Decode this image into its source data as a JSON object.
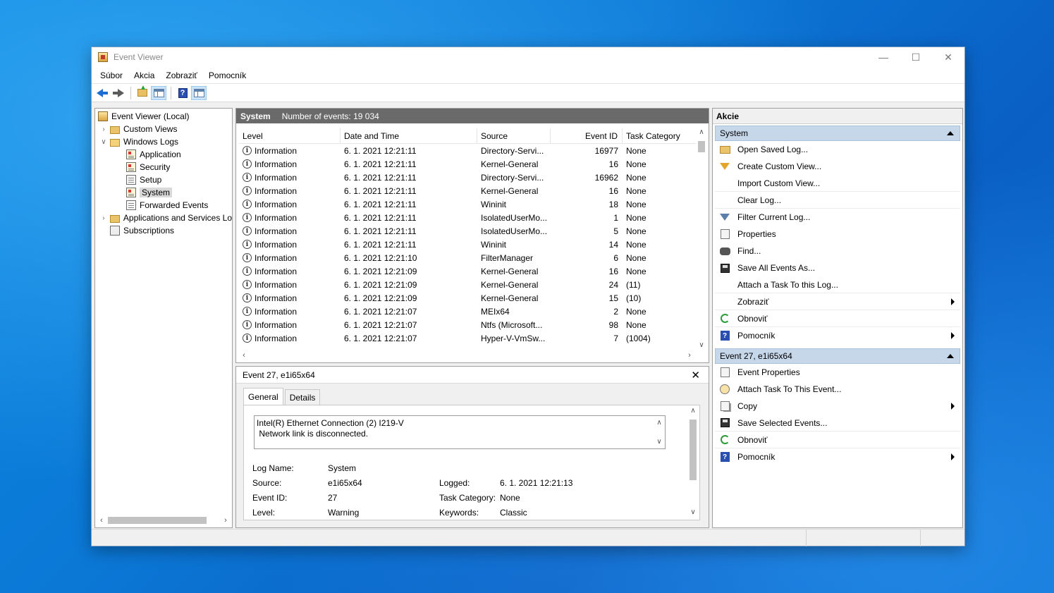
{
  "window": {
    "title": "Event Viewer",
    "controls": {
      "minimize": "—",
      "maximize": "☐",
      "close": "✕"
    }
  },
  "menu": [
    "Súbor",
    "Akcia",
    "Zobraziť",
    "Pomocník"
  ],
  "toolbar": {
    "icons": [
      "back-arrow-icon",
      "forward-arrow-icon",
      "up-folder-icon",
      "show-hide-console-tree-icon",
      "help-icon",
      "show-hide-action-pane-icon"
    ]
  },
  "tree": {
    "root": "Event Viewer (Local)",
    "custom_views": "Custom Views",
    "windows_logs": "Windows Logs",
    "logs": [
      "Application",
      "Security",
      "Setup",
      "System",
      "Forwarded Events"
    ],
    "apps_services": "Applications and Services Lo",
    "subscriptions": "Subscriptions",
    "selected": "System"
  },
  "list": {
    "header_title": "System",
    "header_count": "Number of events: 19 034",
    "columns": {
      "level": "Level",
      "date": "Date and Time",
      "source": "Source",
      "event_id": "Event ID",
      "task": "Task Category"
    },
    "rows": [
      {
        "level": "Information",
        "date": "6. 1. 2021 12:21:11",
        "source": "Directory-Servi...",
        "event_id": "16977",
        "task": "None"
      },
      {
        "level": "Information",
        "date": "6. 1. 2021 12:21:11",
        "source": "Kernel-General",
        "event_id": "16",
        "task": "None"
      },
      {
        "level": "Information",
        "date": "6. 1. 2021 12:21:11",
        "source": "Directory-Servi...",
        "event_id": "16962",
        "task": "None"
      },
      {
        "level": "Information",
        "date": "6. 1. 2021 12:21:11",
        "source": "Kernel-General",
        "event_id": "16",
        "task": "None"
      },
      {
        "level": "Information",
        "date": "6. 1. 2021 12:21:11",
        "source": "Wininit",
        "event_id": "18",
        "task": "None"
      },
      {
        "level": "Information",
        "date": "6. 1. 2021 12:21:11",
        "source": "IsolatedUserMo...",
        "event_id": "1",
        "task": "None"
      },
      {
        "level": "Information",
        "date": "6. 1. 2021 12:21:11",
        "source": "IsolatedUserMo...",
        "event_id": "5",
        "task": "None"
      },
      {
        "level": "Information",
        "date": "6. 1. 2021 12:21:11",
        "source": "Wininit",
        "event_id": "14",
        "task": "None"
      },
      {
        "level": "Information",
        "date": "6. 1. 2021 12:21:10",
        "source": "FilterManager",
        "event_id": "6",
        "task": "None"
      },
      {
        "level": "Information",
        "date": "6. 1. 2021 12:21:09",
        "source": "Kernel-General",
        "event_id": "16",
        "task": "None"
      },
      {
        "level": "Information",
        "date": "6. 1. 2021 12:21:09",
        "source": "Kernel-General",
        "event_id": "24",
        "task": "(11)"
      },
      {
        "level": "Information",
        "date": "6. 1. 2021 12:21:09",
        "source": "Kernel-General",
        "event_id": "15",
        "task": "(10)"
      },
      {
        "level": "Information",
        "date": "6. 1. 2021 12:21:07",
        "source": "MEIx64",
        "event_id": "2",
        "task": "None"
      },
      {
        "level": "Information",
        "date": "6. 1. 2021 12:21:07",
        "source": "Ntfs (Microsoft...",
        "event_id": "98",
        "task": "None"
      },
      {
        "level": "Information",
        "date": "6. 1. 2021 12:21:07",
        "source": "Hyper-V-VmSw...",
        "event_id": "7",
        "task": "(1004)"
      }
    ]
  },
  "detail": {
    "title": "Event 27, e1i65x64",
    "close": "✕",
    "tabs": [
      "General",
      "Details"
    ],
    "description_line1": "Intel(R) Ethernet Connection (2) I219-V",
    "description_line2": " Network link is disconnected.",
    "labels": {
      "log_name": "Log Name:",
      "source": "Source:",
      "event_id": "Event ID:",
      "level": "Level:",
      "logged": "Logged:",
      "task_category": "Task Category:",
      "keywords": "Keywords:"
    },
    "values": {
      "log_name": "System",
      "source": "e1i65x64",
      "event_id": "27",
      "level": "Warning",
      "logged": "6. 1. 2021 12:21:13",
      "task_category": "None",
      "keywords": "Classic"
    }
  },
  "actions": {
    "title": "Akcie",
    "section1": "System",
    "section1_items": [
      "Open Saved Log...",
      "Create Custom View...",
      "Import Custom View...",
      "Clear Log...",
      "Filter Current Log...",
      "Properties",
      "Find...",
      "Save All Events As...",
      "Attach a Task To this Log...",
      "Zobraziť",
      "Obnoviť",
      "Pomocník"
    ],
    "section2": "Event 27, e1i65x64",
    "section2_items": [
      "Event Properties",
      "Attach Task To This Event...",
      "Copy",
      "Save Selected Events...",
      "Obnoviť",
      "Pomocník"
    ]
  }
}
